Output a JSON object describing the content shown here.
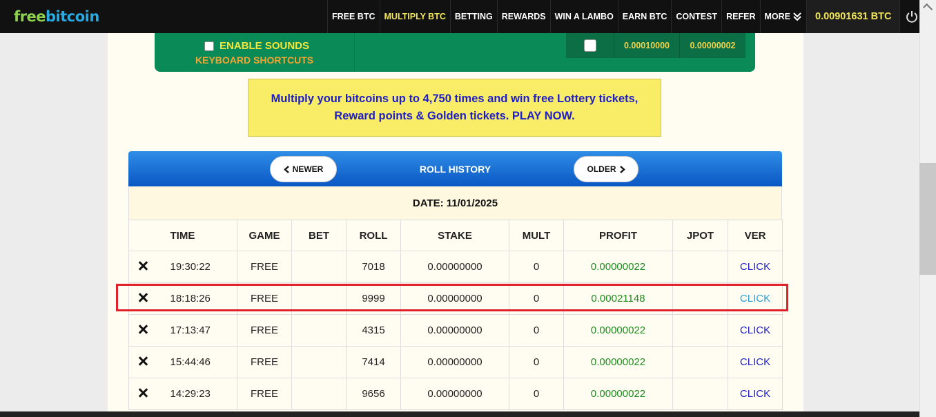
{
  "nav": {
    "logo_part1": "free",
    "logo_part2": "bitcoin",
    "items": [
      {
        "label": "FREE BTC"
      },
      {
        "label": "MULTIPLY BTC"
      },
      {
        "label": "BETTING"
      },
      {
        "label": "REWARDS"
      },
      {
        "label": "WIN A LAMBO"
      },
      {
        "label": "EARN BTC"
      },
      {
        "label": "CONTEST"
      },
      {
        "label": "REFER"
      },
      {
        "label": "MORE"
      }
    ],
    "active": "MULTIPLY BTC",
    "balance": "0.00901631 BTC",
    "more_icon": "double-chevron-down-icon",
    "power_icon": "power-icon"
  },
  "multiply": {
    "sounds_label": "ENABLE SOUNDS",
    "shortcuts_label": "KEYBOARD SHORTCUTS",
    "bet_value_1": "0.00010000",
    "bet_value_2": "0.00000002"
  },
  "promo": {
    "line1": "Multiply your bitcoins up to 4,750 times and win free Lottery tickets,",
    "line2": "Reward points & Golden tickets. PLAY NOW."
  },
  "roll_history": {
    "title": "ROLL HISTORY",
    "newer_label": "NEWER",
    "older_label": "OLDER",
    "date_label": "DATE: 11/01/2025",
    "columns": [
      "TIME",
      "GAME",
      "BET",
      "ROLL",
      "STAKE",
      "MULT",
      "PROFIT",
      "JPOT",
      "VER"
    ],
    "rows": [
      {
        "time": "19:30:22",
        "game": "FREE",
        "bet": "",
        "roll": "7018",
        "stake": "0.00000000",
        "mult": "0",
        "profit": "0.00000022",
        "jpot": "",
        "ver": "CLICK"
      },
      {
        "time": "18:18:26",
        "game": "FREE",
        "bet": "",
        "roll": "9999",
        "stake": "0.00000000",
        "mult": "0",
        "profit": "0.00021148",
        "jpot": "",
        "ver": "CLICK"
      },
      {
        "time": "17:13:47",
        "game": "FREE",
        "bet": "",
        "roll": "4315",
        "stake": "0.00000000",
        "mult": "0",
        "profit": "0.00000022",
        "jpot": "",
        "ver": "CLICK"
      },
      {
        "time": "15:44:46",
        "game": "FREE",
        "bet": "",
        "roll": "7414",
        "stake": "0.00000000",
        "mult": "0",
        "profit": "0.00000022",
        "jpot": "",
        "ver": "CLICK"
      },
      {
        "time": "14:29:23",
        "game": "FREE",
        "bet": "",
        "roll": "9656",
        "stake": "0.00000000",
        "mult": "0",
        "profit": "0.00000022",
        "jpot": "",
        "ver": "CLICK"
      }
    ],
    "highlighted_row": 1
  },
  "colors": {
    "nav_bg": "#111111",
    "active_nav": "#f2e65a",
    "green_box": "#0a8a57",
    "promo_bg": "#f9ec66",
    "promo_text": "#1e1ec8",
    "header_blue": "#0a57c4",
    "profit_green": "#1f8a1f",
    "highlight_red": "#e0202a"
  }
}
